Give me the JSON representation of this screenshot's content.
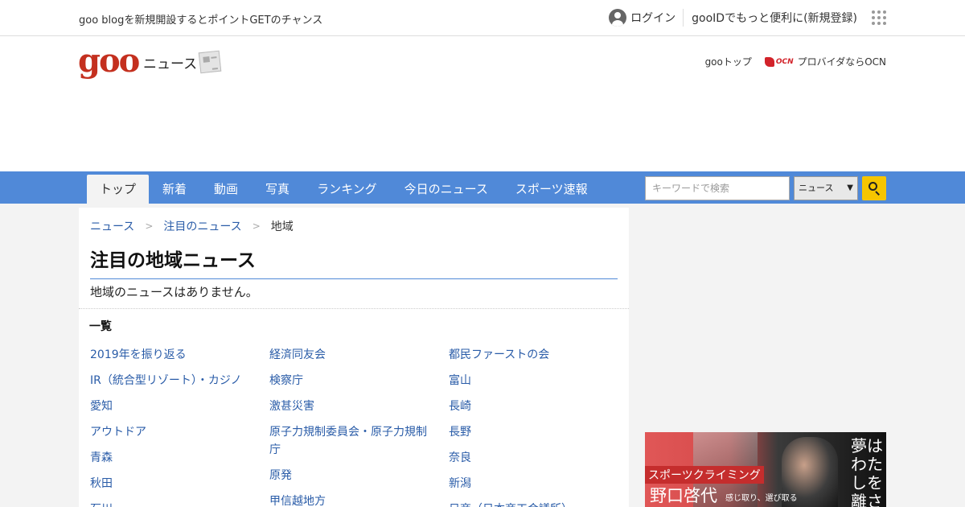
{
  "topbar": {
    "promo": "goo blogを新規開設するとポイントGETのチャンス",
    "login": "ログイン",
    "register": "gooIDでもっと便利に(新規登録)"
  },
  "header": {
    "logo": "goo",
    "section": "ニュース",
    "goo_top": "gooトップ",
    "ocn_mark": "OCN",
    "ocn_link": "プロバイダならOCN"
  },
  "nav": {
    "tabs": [
      "トップ",
      "新着",
      "動画",
      "写真",
      "ランキング",
      "今日のニュース",
      "スポーツ速報"
    ],
    "active_tab": 0,
    "search_placeholder": "キーワードで検索",
    "search_scope": "ニュース"
  },
  "breadcrumb": {
    "items": [
      "ニュース",
      "注目のニュース"
    ],
    "separator": ">",
    "current": "地域"
  },
  "main": {
    "title": "注目の地域ニュース",
    "empty_message": "地域のニュースはありません。",
    "list_heading": "一覧"
  },
  "topics": {
    "col1": [
      "2019年を振り返る",
      "IR（統合型リゾート）・カジノ",
      "愛知",
      "アウトドア",
      "青森",
      "秋田",
      "石川"
    ],
    "col2": [
      "経済同友会",
      "検察庁",
      "激甚災害",
      "原子力規制委員会・原子力規制庁",
      "原発",
      "甲信越地方"
    ],
    "col3": [
      "都民ファーストの会",
      "富山",
      "長崎",
      "長野",
      "奈良",
      "新潟",
      "日商（日本商工会議所）"
    ]
  },
  "ad": {
    "tag": "スポーツクライミング",
    "name": "野口啓代",
    "slogan": "感じ取り、選び取る",
    "vertical": "夢はわたしを離さない"
  },
  "colors": {
    "nav_bg": "#5089d8",
    "link": "#2a5ca8",
    "logo": "#c4301f",
    "search_button": "#f6c500"
  }
}
